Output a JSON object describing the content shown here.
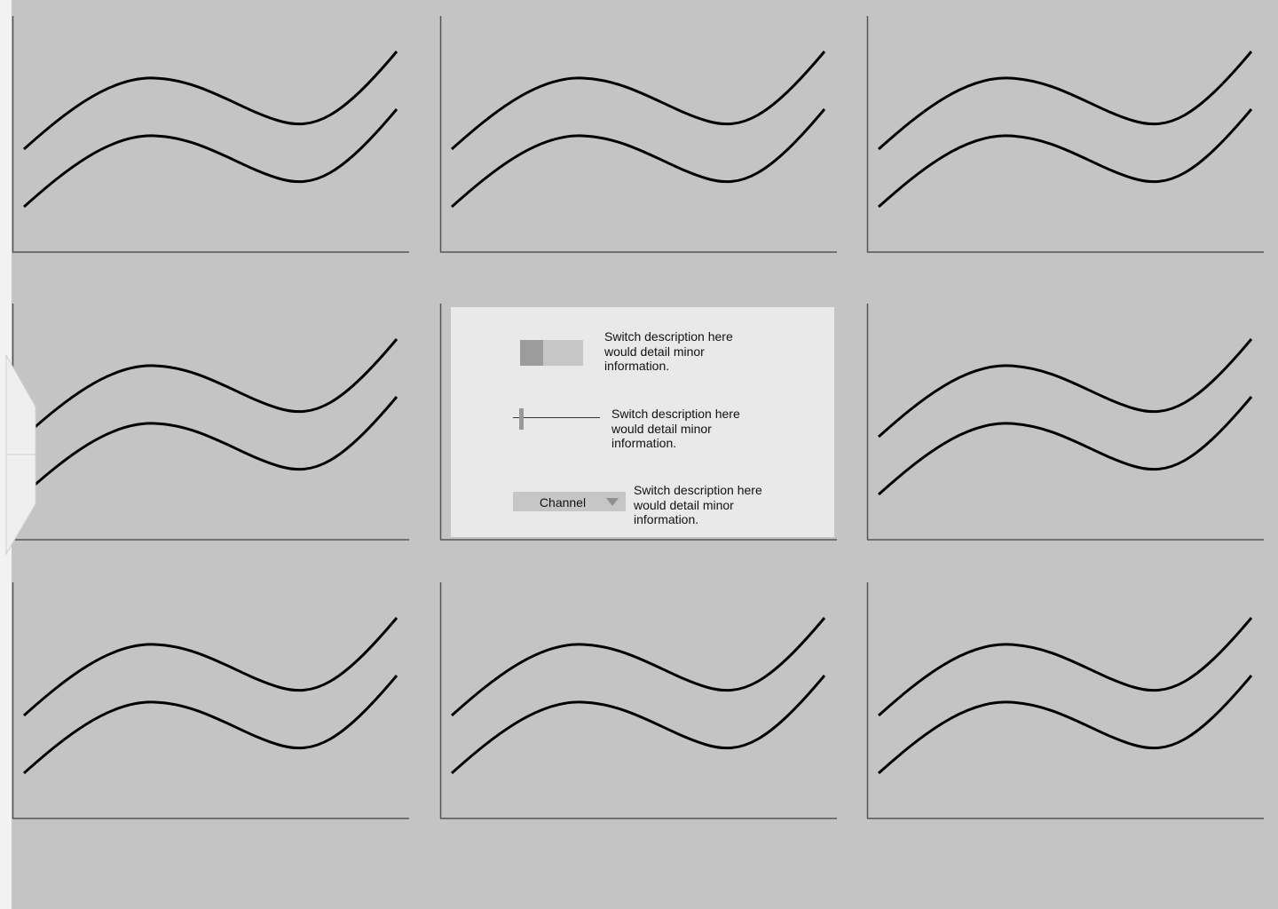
{
  "charts": [
    {
      "id": "chart-r1-c1"
    },
    {
      "id": "chart-r1-c2"
    },
    {
      "id": "chart-r1-c3"
    },
    {
      "id": "chart-r2-c1"
    },
    {
      "id": "chart-r2-c2"
    },
    {
      "id": "chart-r2-c3"
    },
    {
      "id": "chart-r3-c1"
    },
    {
      "id": "chart-r3-c2"
    },
    {
      "id": "chart-r3-c3"
    }
  ],
  "panel": {
    "toggle": {
      "description": "Switch description here would detail minor information."
    },
    "slider": {
      "description": "Switch description here would detail minor information."
    },
    "select": {
      "value": "Channel",
      "description": "Switch description here would detail minor information."
    }
  },
  "icons": {
    "pull_tab": "pull-tab-icon",
    "select_caret": "caret-down-icon"
  },
  "colors": {
    "background": "#c4c4c4",
    "panel": "#e9e9e9",
    "curve": "#000000"
  }
}
